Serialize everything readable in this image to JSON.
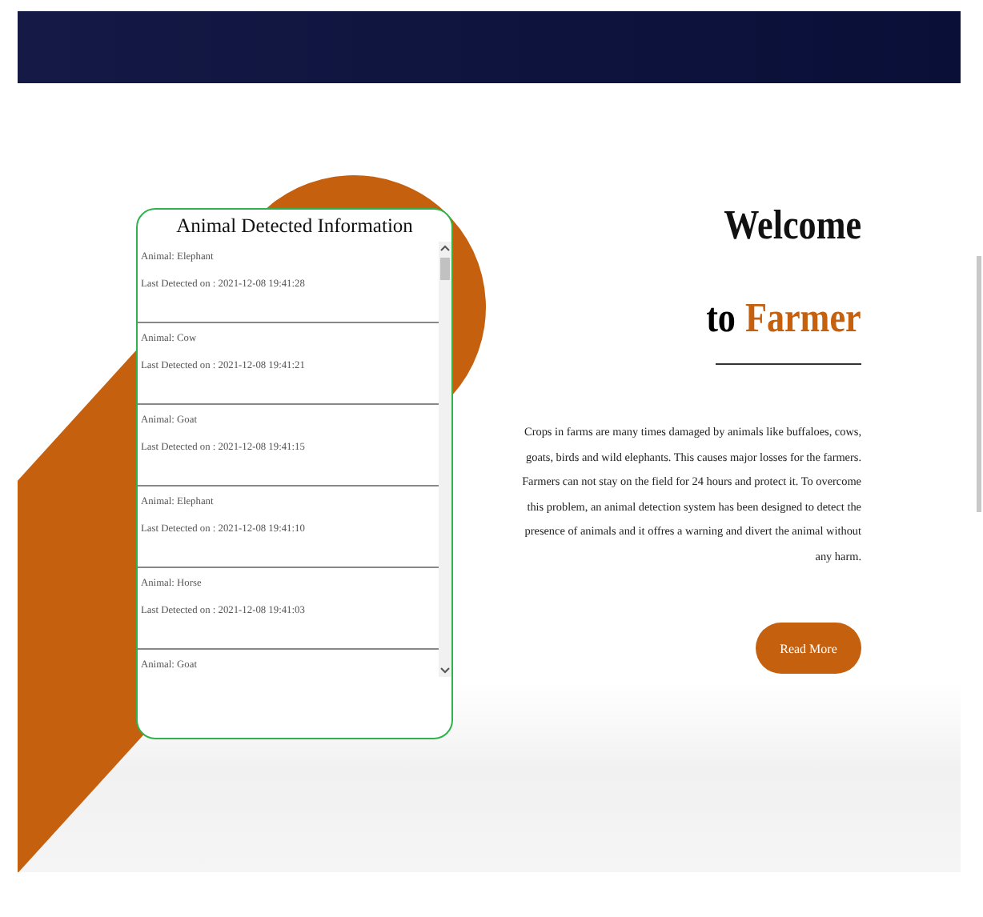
{
  "panel": {
    "title": "Animal Detected Information",
    "detections": [
      {
        "animal": "Animal: Elephant",
        "time": "Last Detected on : 2021-12-08 19:41:28"
      },
      {
        "animal": "Animal: Cow",
        "time": "Last Detected on : 2021-12-08 19:41:21"
      },
      {
        "animal": "Animal: Goat",
        "time": "Last Detected on : 2021-12-08 19:41:15"
      },
      {
        "animal": "Animal: Elephant",
        "time": "Last Detected on : 2021-12-08 19:41:10"
      },
      {
        "animal": "Animal: Horse",
        "time": "Last Detected on : 2021-12-08 19:41:03"
      },
      {
        "animal": "Animal: Goat"
      }
    ]
  },
  "hero": {
    "heading_line1": "Welcome",
    "heading_to": "to",
    "heading_brand": "Farmer",
    "description": "Crops in farms are many times damaged by animals like buffaloes, cows, goats, birds and wild elephants. This causes major losses for the farmers. Farmers can not stay on the field for 24 hours and protect it. To overcome this problem, an animal detection system has been designed to detect the presence of animals and it offres a warning and divert the animal without any harm.",
    "button": "Read More"
  }
}
